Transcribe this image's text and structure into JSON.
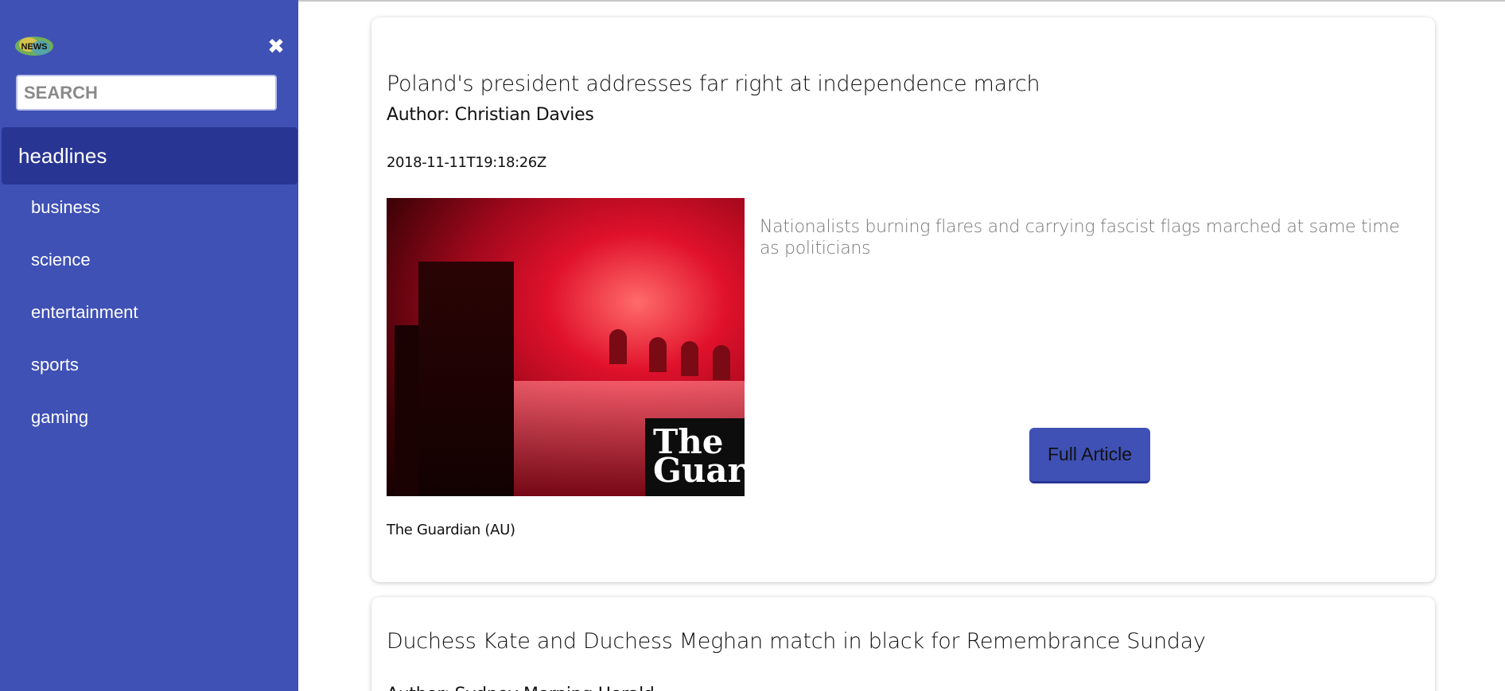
{
  "sidebar": {
    "logo_text": "NEWS",
    "close_icon": "close-icon",
    "search_placeholder": "SEARCH",
    "active_item": "headlines",
    "items": [
      {
        "label": "business"
      },
      {
        "label": "science"
      },
      {
        "label": "entertainment"
      },
      {
        "label": "sports"
      },
      {
        "label": "gaming"
      }
    ]
  },
  "articles": [
    {
      "title": "Poland's president addresses far right at independence march",
      "author": "Author: Christian Davies",
      "date": "2018-11-11T19:18:26Z",
      "description": "Nationalists burning flares and carrying fascist flags marched at same time as politicians",
      "button_label": "Full Article",
      "source": "The Guardian (AU)",
      "image_watermark": "The Guardian"
    },
    {
      "title": "Duchess Kate and Duchess Meghan match in black for Remembrance Sunday",
      "author": "Author: Sydney Morning Herald"
    }
  ],
  "colors": {
    "sidebar": "#3f51b5",
    "sidebar_active": "#283593",
    "button": "#3f51b5"
  }
}
